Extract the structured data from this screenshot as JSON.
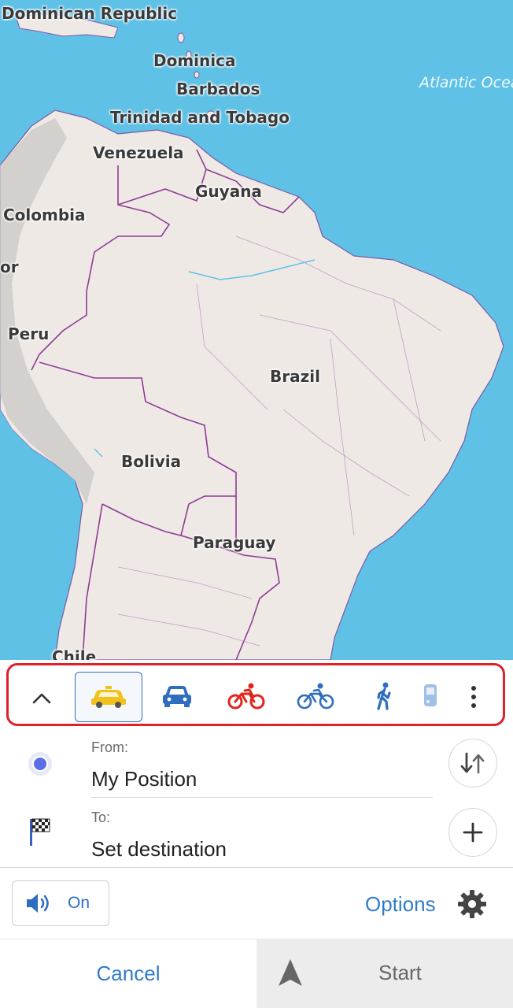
{
  "map": {
    "labels": {
      "dominican_republic": "Dominican Republic",
      "dominica": "Dominica",
      "barbados": "Barbados",
      "trinidad": "Trinidad and Tobago",
      "venezuela": "Venezuela",
      "guyana": "Guyana",
      "colombia": "Colombia",
      "ecuador_partial": "or",
      "peru": "Peru",
      "brazil": "Brazil",
      "bolivia": "Bolivia",
      "paraguay": "Paraguay",
      "chile": "Chile",
      "atlantic": "Atlantic Ocea"
    },
    "colors": {
      "water": "#5fc1e6",
      "land": "#efe9e6",
      "border": "#8e3c93"
    }
  },
  "mode_bar": {
    "modes": [
      {
        "name": "taxi",
        "icon": "taxi-icon",
        "color": "#f2c21b",
        "selected": true
      },
      {
        "name": "car",
        "icon": "car-icon",
        "color": "#2f6ebf",
        "selected": false
      },
      {
        "name": "mountain-bike",
        "icon": "motorbike-icon",
        "color": "#e0261d",
        "selected": false
      },
      {
        "name": "bicycle",
        "icon": "bicycle-icon",
        "color": "#2f6ebf",
        "selected": false
      },
      {
        "name": "pedestrian",
        "icon": "pedestrian-icon",
        "color": "#2f6ebf",
        "selected": false
      },
      {
        "name": "public-transport",
        "icon": "bus-icon",
        "color": "#9ec0e6",
        "selected": false
      }
    ]
  },
  "route": {
    "from_label": "From:",
    "from_value": "My Position",
    "to_label": "To:",
    "to_value": "Set destination"
  },
  "controls": {
    "voice_label": "On",
    "options_label": "Options"
  },
  "actions": {
    "cancel_label": "Cancel",
    "start_label": "Start"
  }
}
